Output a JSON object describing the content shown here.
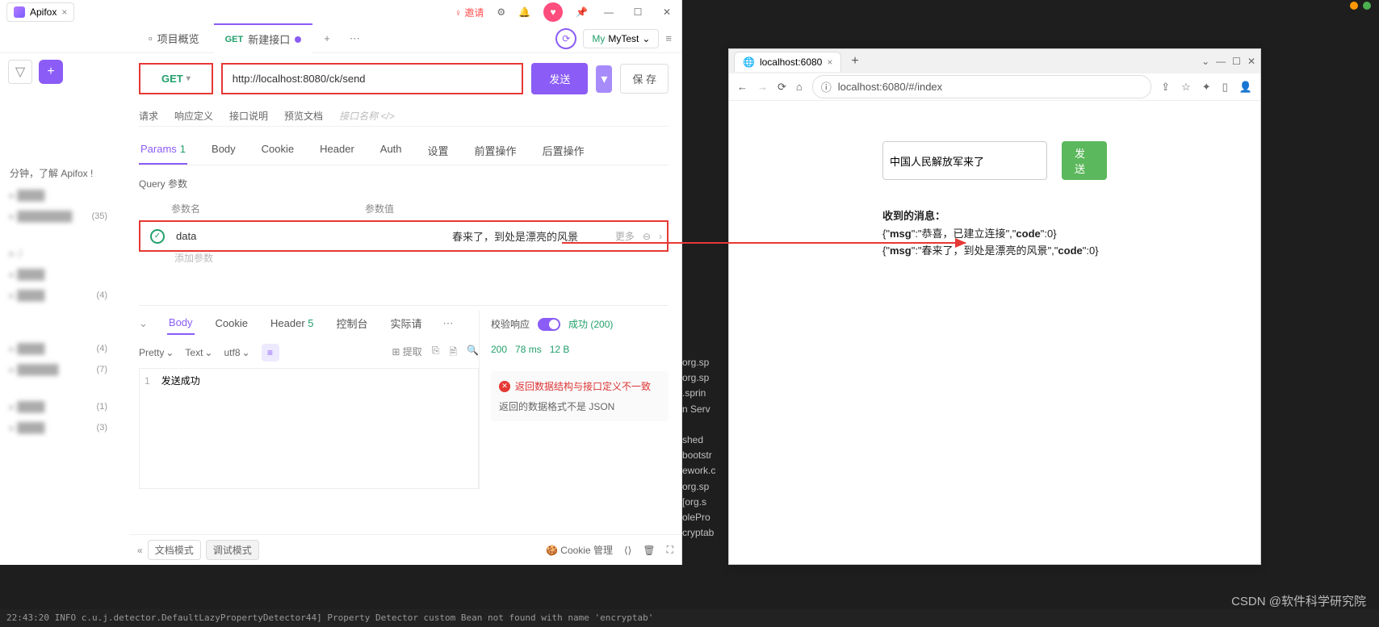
{
  "apifox": {
    "appTab": {
      "name": "Apifox"
    },
    "invite": "邀请",
    "topTabs": {
      "overview": "项目概览",
      "active_method": "GET",
      "active_name": "新建接口"
    },
    "env": {
      "my": "My",
      "name": "MyTest"
    },
    "method": "GET",
    "url": "http://localhost:8080/ck/send",
    "sendBtn": "发送",
    "saveBtn": "保 存",
    "subtabs": {
      "request": "请求",
      "respDef": "响应定义",
      "desc": "接口说明",
      "preview": "预览文档",
      "placeholder": "接口名称 </>"
    },
    "paramTabs": {
      "params": "Params",
      "params_count": "1",
      "body": "Body",
      "cookie": "Cookie",
      "header": "Header",
      "auth": "Auth",
      "settings": "设置",
      "pre": "前置操作",
      "post": "后置操作"
    },
    "queryLabel": "Query 参数",
    "tableHead": {
      "name": "参数名",
      "value": "参数值"
    },
    "paramRow": {
      "name": "data",
      "value": "春来了，到处是漂亮的风景",
      "more": "更多"
    },
    "addParam": "添加参数",
    "response": {
      "tabs": {
        "body": "Body",
        "cookie": "Cookie",
        "header": "Header",
        "header_count": "5",
        "console": "控制台",
        "actual": "实际请"
      },
      "toolbar": {
        "pretty": "Pretty",
        "text": "Text",
        "utf8": "utf8",
        "extract": "提取"
      },
      "code": "发送成功",
      "verify": "校验响应",
      "status": "成功 (200)",
      "metrics": {
        "code": "200",
        "time": "78 ms",
        "size": "12 B"
      },
      "errTitle": "返回数据结构与接口定义不一致",
      "errSub": "返回的数据格式不是 JSON"
    },
    "bottomBar": {
      "doc": "文档模式",
      "debug": "调试模式",
      "cookie": "Cookie 管理"
    }
  },
  "sidebarIntro": "分钟，了解 Apifox !",
  "sidebarCounts": [
    "(35)",
    "(4)",
    "(4)",
    "(7)",
    "(1)",
    "(3)"
  ],
  "darkLines": [
    "org.sp",
    "org.sp",
    ".sprin",
    "n Serv",
    "",
    "shed",
    "bootstr",
    "ework.c",
    "org.sp",
    "[org.s",
    "olePro",
    "cryptab"
  ],
  "logBottom": "22:43:20 INFO  c.u.j.detector.DefaultLazyPropertyDetector44] Property Detector custom Bean not found with name 'encryptab'",
  "browser": {
    "tabTitle": "localhost:6080",
    "url": "localhost:6080/#/index",
    "inputValue": "中国人民解放军来了",
    "sendBtn": "发送",
    "recvLabel": "收到的消息：",
    "lines": [
      {
        "msg": "恭喜，已建立连接",
        "code": "0"
      },
      {
        "msg": "春来了，到处是漂亮的风景",
        "code": "0"
      }
    ]
  },
  "watermark": "CSDN @软件科学研究院"
}
